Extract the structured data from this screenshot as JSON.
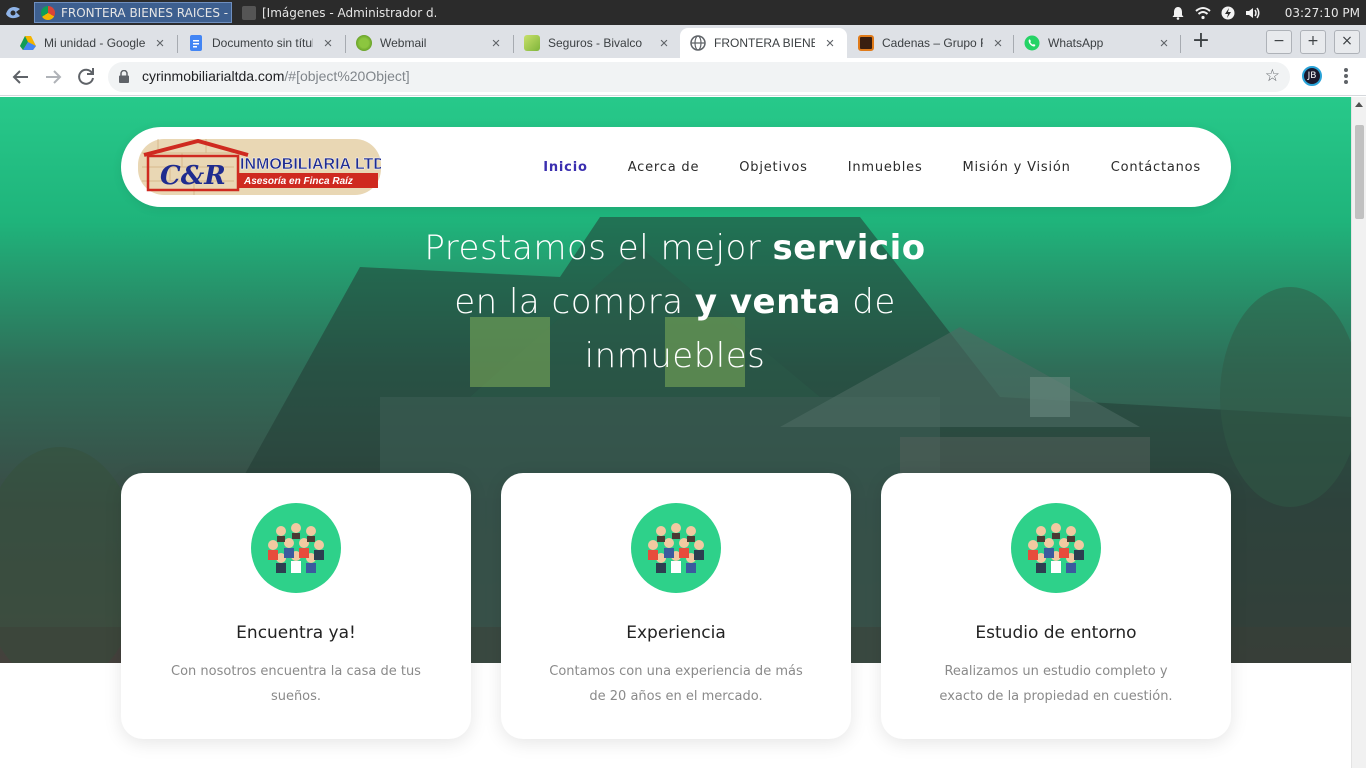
{
  "os": {
    "tasks": [
      {
        "label": "FRONTERA BIENES RAICES - ...",
        "active": true
      },
      {
        "label": "[Imágenes - Administrador d...",
        "active": false
      }
    ],
    "clock": "03:27:10 PM"
  },
  "browser": {
    "tabs": [
      {
        "label": "Mi unidad - Google Drive",
        "icon": "google-drive-icon"
      },
      {
        "label": "Documento sin título",
        "icon": "google-docs-icon"
      },
      {
        "label": "Webmail",
        "icon": "webmail-icon"
      },
      {
        "label": "Seguros - Bivalco",
        "icon": "bivalco-icon"
      },
      {
        "label": "FRONTERA BIENES RAICES",
        "icon": "globe-icon",
        "active": true
      },
      {
        "label": "Cadenas – Grupo Fénix",
        "icon": "cadenas-icon"
      },
      {
        "label": "WhatsApp",
        "icon": "whatsapp-icon"
      }
    ],
    "url_host": "cyrinmobiliarialtda.com",
    "url_path": "/#[object%20Object]",
    "profile_initials": "JB"
  },
  "site": {
    "logo_text": "C & R",
    "logo_title": "INMOBILIARIA LTDA.",
    "logo_tagline": "Asesoría en Finca Raíz",
    "menu": [
      {
        "label": "Inicio",
        "active": true
      },
      {
        "label": "Acerca de"
      },
      {
        "label": "Objetivos"
      },
      {
        "label": "Inmuebles"
      },
      {
        "label": "Misión y Visión"
      },
      {
        "label": "Contáctanos"
      }
    ],
    "headline": {
      "p1": "Prestamos el mejor ",
      "b1": "servicio",
      "p2": "en la compra ",
      "b2": "y venta",
      "p3": " de",
      "p4": "inmuebles"
    },
    "features": [
      {
        "title": "Encuentra ya!",
        "desc": "Con nosotros encuentra la casa de tus sueños."
      },
      {
        "title": "Experiencia",
        "desc": "Contamos con una experiencia de más de 20 años en el mercado."
      },
      {
        "title": "Estudio de entorno",
        "desc": "Realizamos un estudio completo y exacto de la propiedad en cuestión."
      }
    ]
  },
  "colors": {
    "hero_green": "#27c98a",
    "menu_active": "#3b2fb0",
    "icon_circle": "#2ed18a"
  }
}
